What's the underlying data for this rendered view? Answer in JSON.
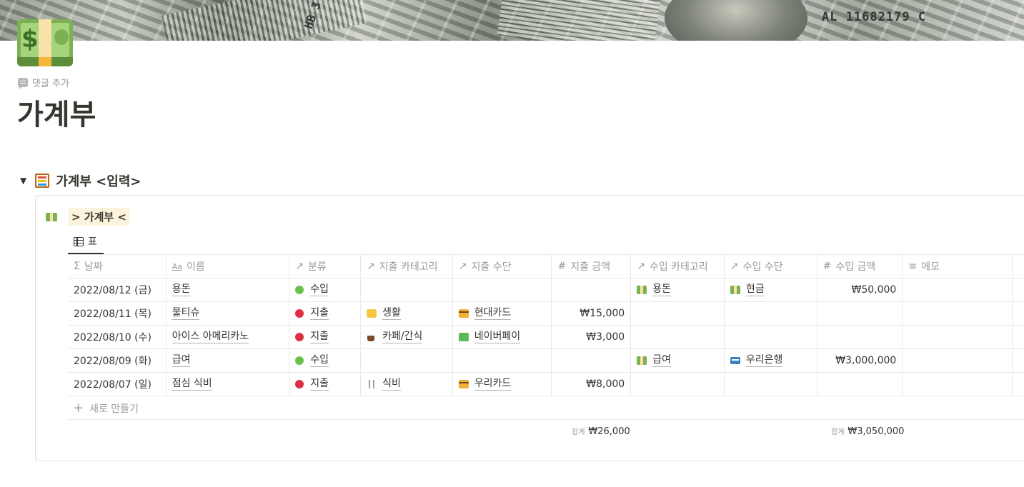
{
  "cover": {
    "serial_text": "AL 11682179 C",
    "side_text": "HB 3"
  },
  "page": {
    "icon": "dollar-banknote-icon",
    "comment_add_label": "댓글 추가",
    "title": "가계부"
  },
  "toggle": {
    "icon": "abacus-icon",
    "label": "가계부 <입력>"
  },
  "database": {
    "title": "> 가계부 <",
    "view_tab_label": "표",
    "columns": [
      {
        "label": "날짜",
        "icon": "sigma-icon"
      },
      {
        "label": "이름",
        "icon": "text-aa-icon"
      },
      {
        "label": "분류",
        "icon": "relation-arrow-icon"
      },
      {
        "label": "지출 카테고리",
        "icon": "relation-arrow-icon"
      },
      {
        "label": "지출 수단",
        "icon": "relation-arrow-icon"
      },
      {
        "label": "지출 금액",
        "icon": "hash-icon"
      },
      {
        "label": "수입 카테고리",
        "icon": "relation-arrow-icon"
      },
      {
        "label": "수입 수단",
        "icon": "relation-arrow-icon"
      },
      {
        "label": "수입 금액",
        "icon": "hash-icon"
      },
      {
        "label": "메모",
        "icon": "text-lines-icon"
      }
    ],
    "rows": [
      {
        "date": "2022/08/12 (금)",
        "name": "용돈",
        "type": "수입",
        "type_color": "#6cc04a",
        "exp_cat": "",
        "exp_cat_icon": "",
        "exp_method": "",
        "exp_method_icon": "",
        "exp_amount": "",
        "inc_cat": "용돈",
        "inc_cat_icon": "money",
        "inc_method": "현금",
        "inc_method_icon": "money",
        "inc_amount": "₩50,000",
        "memo": ""
      },
      {
        "date": "2022/08/11 (목)",
        "name": "물티슈",
        "type": "지출",
        "type_color": "#dd2e44",
        "exp_cat": "생활",
        "exp_cat_icon": "life",
        "exp_method": "현대카드",
        "exp_method_icon": "card",
        "exp_amount": "₩15,000",
        "inc_cat": "",
        "inc_cat_icon": "",
        "inc_method": "",
        "inc_method_icon": "",
        "inc_amount": "",
        "memo": ""
      },
      {
        "date": "2022/08/10 (수)",
        "name": "아이스 아메리카노",
        "type": "지출",
        "type_color": "#dd2e44",
        "exp_cat": "카페/간식",
        "exp_cat_icon": "cafe",
        "exp_method": "네이버페이",
        "exp_method_icon": "naver",
        "exp_amount": "₩3,000",
        "inc_cat": "",
        "inc_cat_icon": "",
        "inc_method": "",
        "inc_method_icon": "",
        "inc_amount": "",
        "memo": ""
      },
      {
        "date": "2022/08/09 (화)",
        "name": "급여",
        "type": "수입",
        "type_color": "#6cc04a",
        "exp_cat": "",
        "exp_cat_icon": "",
        "exp_method": "",
        "exp_method_icon": "",
        "exp_amount": "",
        "inc_cat": "급여",
        "inc_cat_icon": "money",
        "inc_method": "우리은행",
        "inc_method_icon": "bank",
        "inc_amount": "₩3,000,000",
        "memo": ""
      },
      {
        "date": "2022/08/07 (일)",
        "name": "점심 식비",
        "type": "지출",
        "type_color": "#dd2e44",
        "exp_cat": "식비",
        "exp_cat_icon": "food",
        "exp_method": "우리카드",
        "exp_method_icon": "card",
        "exp_amount": "₩8,000",
        "inc_cat": "",
        "inc_cat_icon": "",
        "inc_method": "",
        "inc_method_icon": "",
        "inc_amount": "",
        "memo": ""
      }
    ],
    "new_row_label": "새로 만들기",
    "sum_label": "합계",
    "exp_sum": "₩26,000",
    "inc_sum": "₩3,050,000"
  }
}
